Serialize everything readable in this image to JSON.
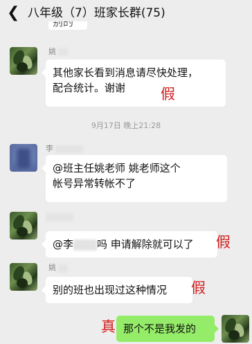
{
  "header": {
    "back_icon": "chevron-left-icon",
    "title": "八年级（7）班家长群(75)"
  },
  "top_partial": "别的",
  "messages": [
    {
      "sender": "姚",
      "lines": [
        "其他家长看到消息请尽快处理，",
        "配合统计。谢谢"
      ],
      "mark": "假"
    },
    {
      "sender": "李",
      "lines": [
        "@班主任姚老师    姚老师这个",
        "帐号异常转帐不了"
      ]
    },
    {
      "sender": "",
      "prefix": "@李",
      "suffix": "吗  申请解除就可以了",
      "mark": "假"
    },
    {
      "sender": "姚",
      "lines": [
        "别的班也出现过这种情况"
      ],
      "mark": "假"
    }
  ],
  "timestamp": "9月17日 晚上21:28",
  "self_message": {
    "text": "那个不是我发的",
    "mark": "真"
  },
  "colors": {
    "background": "#ededed",
    "bubble": "#ffffff",
    "self_bubble": "#95ec69",
    "mark": "#d21f1f"
  }
}
